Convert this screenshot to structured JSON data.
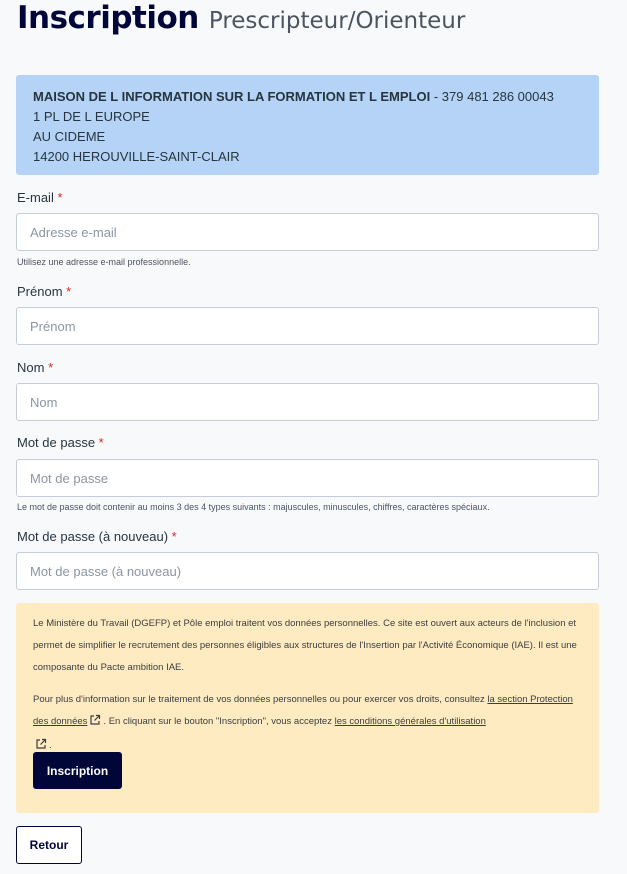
{
  "header": {
    "title": "Inscription",
    "subtitle": "Prescripteur/Orienteur"
  },
  "organization": {
    "name": "MAISON DE L INFORMATION SUR LA FORMATION ET L EMPLOI",
    "siret_sep": " - ",
    "siret": "379 481 286 00043",
    "address_line1": "1 PL DE L EUROPE",
    "address_line2": "AU CIDEME",
    "address_line3": "14200 HEROUVILLE-SAINT-CLAIR"
  },
  "form": {
    "required_mark": "*",
    "email": {
      "label": "E-mail ",
      "placeholder": "Adresse e-mail",
      "value": "",
      "help": "Utilisez une adresse e-mail professionnelle."
    },
    "first_name": {
      "label": "Prénom ",
      "placeholder": "Prénom",
      "value": ""
    },
    "last_name": {
      "label": "Nom ",
      "placeholder": "Nom",
      "value": ""
    },
    "password": {
      "label": "Mot de passe ",
      "placeholder": "Mot de passe",
      "value": "",
      "help": "Le mot de passe doit contenir au moins 3 des 4 types suivants : majuscules, minuscules, chiffres, caractères spéciaux."
    },
    "password_confirm": {
      "label": "Mot de passe (à nouveau) ",
      "placeholder": "Mot de passe (à nouveau)",
      "value": ""
    }
  },
  "notice": {
    "paragraph1": "Le Ministère du Travail (DGEFP) et Pôle emploi traitent vos données personnelles. Ce site est ouvert aux acteurs de l'inclusion et permet de simplifier le recrutement des personnes éligibles aux structures de l'Insertion par l'Activité Économique (IAE). Il est une composante du Pacte ambition IAE.",
    "paragraph2_before": "Pour plus d'information sur le traitement de vos données personnelles ou pour exercer vos droits, consultez ",
    "link_protection": "la section Protection des données",
    "paragraph2_middle": ". En cliquant sur le bouton \"Inscription\", vous acceptez ",
    "link_cgu": "les conditions générales d'utilisation",
    "paragraph2_end": "."
  },
  "buttons": {
    "submit": "Inscription",
    "back": "Retour"
  },
  "icons": {
    "external_link": "external-link-icon"
  }
}
